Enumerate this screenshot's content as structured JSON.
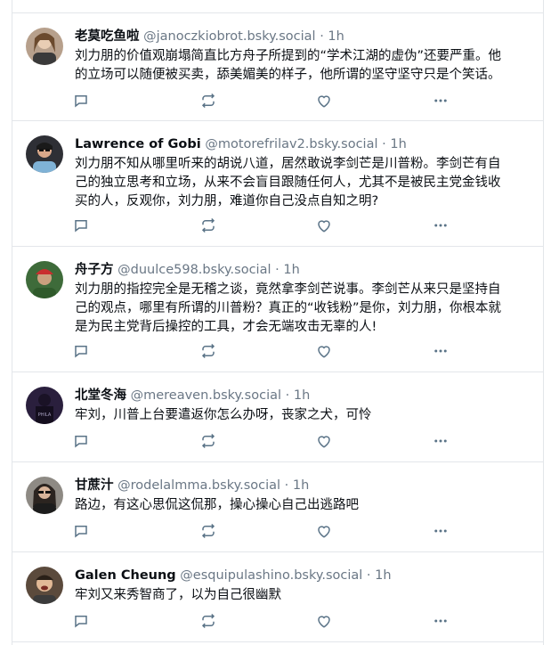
{
  "posts": [
    {
      "name": "老莫吃鱼啦",
      "handle": "@janoczkiobrot.bsky.social",
      "time": "1h",
      "lines": [
        "刘力朋的价值观崩塌简直比方舟子所提到的“学术江湖的虚伪”还要严重。他",
        "的立场可以随便被买卖，舔美媚美的样子，他所谓的坚守坚守只是个笑话。"
      ],
      "avatar_bg": "#b7a08c"
    },
    {
      "name": "Lawrence of Gobi",
      "handle": "@motorefrilav2.bsky.social",
      "time": "1h",
      "lines": [
        "刘力朋不知从哪里听来的胡说八道，居然敢说李剑芒是川普粉。李剑芒有自",
        "己的独立思考和立场，从来不会盲目跟随任何人，尤其不是被民主党金钱收",
        "买的人，反观你，刘力朋，难道你自己没点自知之明?"
      ],
      "avatar_bg": "#2e2f35"
    },
    {
      "name": "舟子方",
      "handle": "@duulce598.bsky.social",
      "time": "1h",
      "lines": [
        "刘力朋的指控完全是无稽之谈，竟然拿李剑芒说事。李剑芒从来只是坚持自",
        "己的观点，哪里有所谓的川普粉？真正的“收钱粉”是你，刘力朋，你根本就",
        "是为民主党背后操控的工具，才会无端攻击无辜的人!"
      ],
      "avatar_bg": "#3e6b3a"
    },
    {
      "name": "北堂冬海",
      "handle": "@mereaven.bsky.social",
      "time": "1h",
      "lines": [
        "牢刘，川普上台要遣返你怎么办呀，丧家之犬，可怜"
      ],
      "avatar_bg": "#2a1f3d"
    },
    {
      "name": "甘蔗汁",
      "handle": "@rodelalmma.bsky.social",
      "time": "1h",
      "lines": [
        "路边，有这心思侃这侃那，操心操心自己出逃路吧"
      ],
      "avatar_bg": "#8e8a84"
    },
    {
      "name": "Galen Cheung",
      "handle": "@esquipulashino.bsky.social",
      "time": "1h",
      "lines": [
        "牢刘又来秀智商了，以为自己很幽默"
      ],
      "avatar_bg": "#5b4a3c"
    }
  ],
  "separator": "·",
  "colors": {
    "icon": "#5a7387",
    "border": "#e3e6ea",
    "muted": "#6a7785"
  },
  "icons": [
    "reply-icon",
    "repost-icon",
    "like-icon",
    "more-icon"
  ]
}
